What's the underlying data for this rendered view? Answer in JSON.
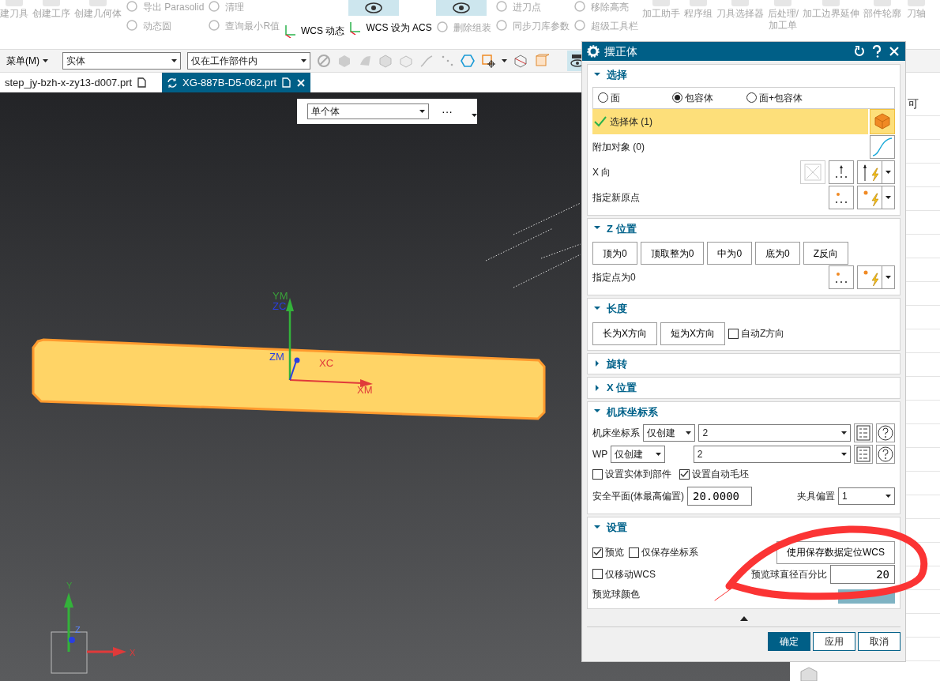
{
  "ribbon": {
    "columns": [
      {
        "items": [
          {
            "kind": "large",
            "label": "建刀具",
            "disabled": true
          }
        ]
      },
      {
        "items": [
          {
            "kind": "large",
            "label": "创建工序",
            "disabled": true
          }
        ]
      },
      {
        "items": [
          {
            "kind": "large",
            "label": "创建几何体",
            "disabled": true
          }
        ]
      },
      {
        "items": [
          {
            "kind": "small",
            "label": "导出 Parasolid",
            "disabled": true
          },
          {
            "kind": "small",
            "label": "动态圆",
            "disabled": true
          }
        ]
      },
      {
        "items": [
          {
            "kind": "small",
            "label": "清理",
            "disabled": true
          },
          {
            "kind": "small",
            "label": "查询最小R值",
            "disabled": true
          }
        ]
      },
      {
        "items": [
          {
            "kind": "small",
            "label": "WCS 动态",
            "disabled": false
          }
        ]
      },
      {
        "items": [
          {
            "kind": "toggle",
            "on": true
          },
          {
            "kind": "small",
            "label": "WCS 设为 ACS",
            "disabled": false
          }
        ]
      },
      {
        "items": [
          {
            "kind": "toggle",
            "on": true
          },
          {
            "kind": "small",
            "label": "删除组装",
            "disabled": true
          }
        ]
      },
      {
        "items": [
          {
            "kind": "small",
            "label": "进刀点",
            "disabled": true
          },
          {
            "kind": "small",
            "label": "同步刀库参数",
            "disabled": true
          }
        ]
      },
      {
        "items": [
          {
            "kind": "small",
            "label": "移除高亮",
            "disabled": true
          },
          {
            "kind": "small",
            "label": "超级工具栏",
            "disabled": true
          }
        ]
      },
      {
        "items": [
          {
            "kind": "large",
            "label": "加工助手",
            "disabled": true
          }
        ]
      },
      {
        "items": [
          {
            "kind": "large",
            "label": "程序组",
            "disabled": true
          }
        ]
      },
      {
        "items": [
          {
            "kind": "large",
            "label": "刀具选择器",
            "disabled": true
          }
        ]
      },
      {
        "items": [
          {
            "kind": "large",
            "label": "后处理/\n加工单",
            "disabled": true
          }
        ]
      },
      {
        "items": [
          {
            "kind": "large",
            "label": "加工边界延伸",
            "disabled": true
          }
        ]
      },
      {
        "items": [
          {
            "kind": "large",
            "label": "部件轮廓",
            "disabled": true
          }
        ]
      },
      {
        "items": [
          {
            "kind": "large",
            "label": "刀轴",
            "disabled": true
          }
        ]
      }
    ]
  },
  "toolbar": {
    "menu": "菜单(M)",
    "filters": [
      "实体",
      "仅在工作部件内"
    ],
    "mcs_toggle": {
      "on": true
    }
  },
  "tabs": [
    {
      "label": "step_jy-bzh-x-zy13-d007.prt",
      "selected": false
    },
    {
      "label": "XG-887B-D5-062.prt",
      "selected": true
    }
  ],
  "viewport": {
    "selection_bar": {
      "value": "单个体",
      "more": "···"
    },
    "axis_labels": [
      {
        "text": "YM",
        "color": "#3aa03a"
      },
      {
        "text": "ZC",
        "color": "#2a3ee0"
      },
      {
        "text": "ZM",
        "color": "#2a3ee0"
      },
      {
        "text": "XC",
        "color": "#e03a3a"
      },
      {
        "text": "XM",
        "color": "#e03a3a"
      }
    ],
    "triad_labels": [
      {
        "text": "Y",
        "color": "#3aa03a"
      },
      {
        "text": "Z",
        "color": "#5b86ff"
      },
      {
        "text": "X",
        "color": "#e03a3a"
      }
    ]
  },
  "side_panel": {
    "text": "可"
  },
  "dialog": {
    "title": "摆正体",
    "sections": [
      {
        "title": "选择",
        "expanded": true,
        "rows": [
          {
            "kind": "radios",
            "options": [
              {
                "label": "面",
                "selected": false
              },
              {
                "label": "包容体",
                "selected": true
              },
              {
                "label": "面+包容体",
                "selected": false
              }
            ]
          },
          {
            "kind": "selection",
            "label": "选择体 (1)",
            "active": true
          },
          {
            "kind": "curve_picker",
            "label": "附加对象 (0)"
          },
          {
            "kind": "vector_picker",
            "label": "X 向"
          },
          {
            "kind": "point_picker",
            "label": "指定新原点"
          }
        ]
      },
      {
        "title": "Z 位置",
        "expanded": true,
        "rows": [
          {
            "kind": "buttons",
            "buttons": [
              "顶为0",
              "顶取整为0",
              "中为0",
              "底为0",
              "Z反向"
            ]
          },
          {
            "kind": "point_picker",
            "label": "指定点为0"
          }
        ]
      },
      {
        "title": "长度",
        "expanded": true,
        "rows": [
          {
            "kind": "buttons",
            "buttons": [
              "长为X方向",
              "短为X方向"
            ],
            "check": {
              "label": "自动Z方向",
              "checked": false
            }
          }
        ]
      },
      {
        "title": "旋转",
        "expanded": false
      },
      {
        "title": "X 位置",
        "expanded": false
      },
      {
        "title": "机床坐标系",
        "expanded": true,
        "rows": [
          {
            "kind": "combo",
            "label": "机床坐标系",
            "mode": "仅创建",
            "value": "2"
          },
          {
            "kind": "combo",
            "label": "WP",
            "mode": "仅创建",
            "value": "2"
          },
          {
            "kind": "checks",
            "items": [
              {
                "label": "设置实体到部件",
                "checked": false
              },
              {
                "label": "设置自动毛坯",
                "checked": true
              }
            ]
          },
          {
            "kind": "offset",
            "label": "安全平面(体最高偏置)",
            "value": "20.0000",
            "label2": "夹具偏置",
            "value2": "1"
          }
        ]
      },
      {
        "title": "设置",
        "expanded": true,
        "rows": [
          {
            "kind": "check_button",
            "items": [
              {
                "label": "预览",
                "checked": true
              },
              {
                "label": "仅保存坐标系",
                "checked": false
              }
            ],
            "button": "使用保存数据定位WCS"
          },
          {
            "kind": "check_field",
            "check": {
              "label": "仅移动WCS",
              "checked": false
            },
            "label": "预览球直径百分比",
            "value": "20"
          },
          {
            "kind": "color",
            "label": "预览球颜色",
            "color": "#7fb3c3"
          }
        ]
      }
    ],
    "buttons": [
      {
        "label": "确定",
        "primary": true
      },
      {
        "label": "应用",
        "primary": false
      },
      {
        "label": "取消",
        "primary": false
      }
    ]
  }
}
